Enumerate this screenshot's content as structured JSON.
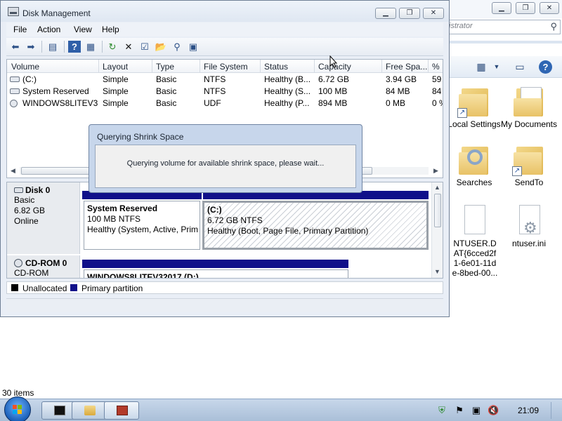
{
  "explorer": {
    "search_placeholder": "istrator",
    "status_text": "30 items",
    "items": [
      {
        "label": "Local Settings",
        "icon": "folder-shortcut-icon"
      },
      {
        "label": "My Documents",
        "icon": "folder-documents-icon"
      },
      {
        "label": "Searches",
        "icon": "searches-folder-icon"
      },
      {
        "label": "SendTo",
        "icon": "folder-shortcut-icon"
      },
      {
        "label": "NTUSER.DAT{6cced2f1-6e01-11de-8bed-00...",
        "icon": "file-icon"
      },
      {
        "label": "ntuser.ini",
        "icon": "settings-file-icon"
      }
    ]
  },
  "disk_management": {
    "title": "Disk Management",
    "menu": {
      "file": "File",
      "action": "Action",
      "view": "View",
      "help": "Help"
    },
    "columns": [
      "Volume",
      "Layout",
      "Type",
      "File System",
      "Status",
      "Capacity",
      "Free Spa...",
      "% F"
    ],
    "volumes": [
      {
        "volume": "(C:)",
        "layout": "Simple",
        "type": "Basic",
        "fs": "NTFS",
        "status": "Healthy (B...",
        "capacity": "6.72 GB",
        "free": "3.94 GB",
        "pct": "59"
      },
      {
        "volume": "System Reserved",
        "layout": "Simple",
        "type": "Basic",
        "fs": "NTFS",
        "status": "Healthy (S...",
        "capacity": "100 MB",
        "free": "84 MB",
        "pct": "84"
      },
      {
        "volume": "WINDOWS8LITEV3...",
        "layout": "Simple",
        "type": "Basic",
        "fs": "UDF",
        "status": "Healthy (P...",
        "capacity": "894 MB",
        "free": "0 MB",
        "pct": "0 %"
      }
    ],
    "disks": [
      {
        "name": "Disk 0",
        "kind": "Basic",
        "size": "6.82 GB",
        "state": "Online",
        "partitions": [
          {
            "title": "System Reserved",
            "line1": "100 MB NTFS",
            "line2": "Healthy (System, Active, Prim"
          },
          {
            "title": "(C:)",
            "line1": "6.72 GB NTFS",
            "line2": "Healthy (Boot, Page File, Primary Partition)"
          }
        ]
      },
      {
        "name": "CD-ROM 0",
        "kind": "CD-ROM",
        "partitions": [
          {
            "title": "WINDOWS8LITEV32017 (D:)"
          }
        ]
      }
    ],
    "legend": {
      "unallocated": "Unallocated",
      "primary": "Primary partition",
      "unallocated_color": "#000000",
      "primary_color": "#10108a"
    }
  },
  "dialog": {
    "title": "Querying Shrink Space",
    "message": "Querying volume for available shrink space, please wait..."
  },
  "taskbar": {
    "clock": "21:09"
  }
}
